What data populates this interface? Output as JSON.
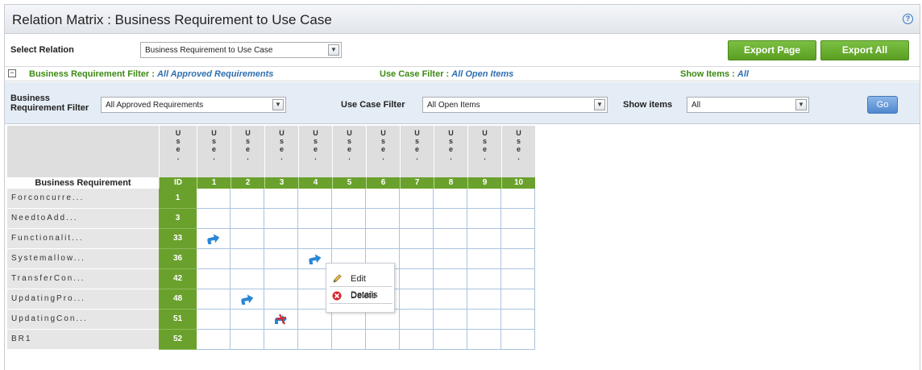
{
  "title": "Relation Matrix : Business Requirement to Use Case",
  "help_icon": "?",
  "relation": {
    "label": "Select Relation",
    "value": "Business Requirement to Use Case"
  },
  "buttons": {
    "export_page": "Export Page",
    "export_all": "Export All",
    "go": "Go"
  },
  "summary": {
    "collapse": "−",
    "br_filter_label": "Business Requirement Filter : ",
    "br_filter_value": "All Approved Requirements",
    "uc_filter_label": "Use Case Filter : ",
    "uc_filter_value": "All Open Items",
    "show_items_label": "Show Items : ",
    "show_items_value": "All"
  },
  "filters": {
    "br_label_line1": "Business",
    "br_label_line2": "Requirement Filter",
    "br_value": "All Approved Requirements",
    "uc_label": "Use Case Filter",
    "uc_value": "All Open Items",
    "show_label": "Show items",
    "show_value": "All"
  },
  "matrix": {
    "row_header": "Business Requirement",
    "id_header": "ID",
    "id_vertical": [
      "U",
      "s",
      "e",
      "."
    ],
    "col_vertical": [
      "U",
      "s",
      "e",
      "."
    ],
    "columns": [
      "1",
      "2",
      "3",
      "4",
      "5",
      "6",
      "7",
      "8",
      "9",
      "10"
    ],
    "rows": [
      {
        "label": "Forconcurre...",
        "id": "1"
      },
      {
        "label": "NeedtoAdd...",
        "id": "3"
      },
      {
        "label": "Functionalit...",
        "id": "33"
      },
      {
        "label": "Systemallow...",
        "id": "36"
      },
      {
        "label": "TransferCon...",
        "id": "42"
      },
      {
        "label": "UpdatingPro...",
        "id": "48"
      },
      {
        "label": "UpdatingCon...",
        "id": "51"
      },
      {
        "label": "BR1",
        "id": "52"
      }
    ],
    "relations": [
      {
        "row": 2,
        "col": 0,
        "icon": "relation-arrow-icon"
      },
      {
        "row": 3,
        "col": 3,
        "icon": "relation-arrow-icon"
      },
      {
        "row": 5,
        "col": 1,
        "icon": "relation-arrow-icon"
      },
      {
        "row": 6,
        "col": 2,
        "icon": "suspect-relation-icon"
      }
    ]
  },
  "context_menu": {
    "edit": "Edit Details",
    "delete": "Delete"
  },
  "colors": {
    "accent_green": "#6aa12c",
    "link_blue": "#2f6fb0",
    "arrow_blue": "#2a86d6",
    "suspect_red": "#d9262b"
  }
}
